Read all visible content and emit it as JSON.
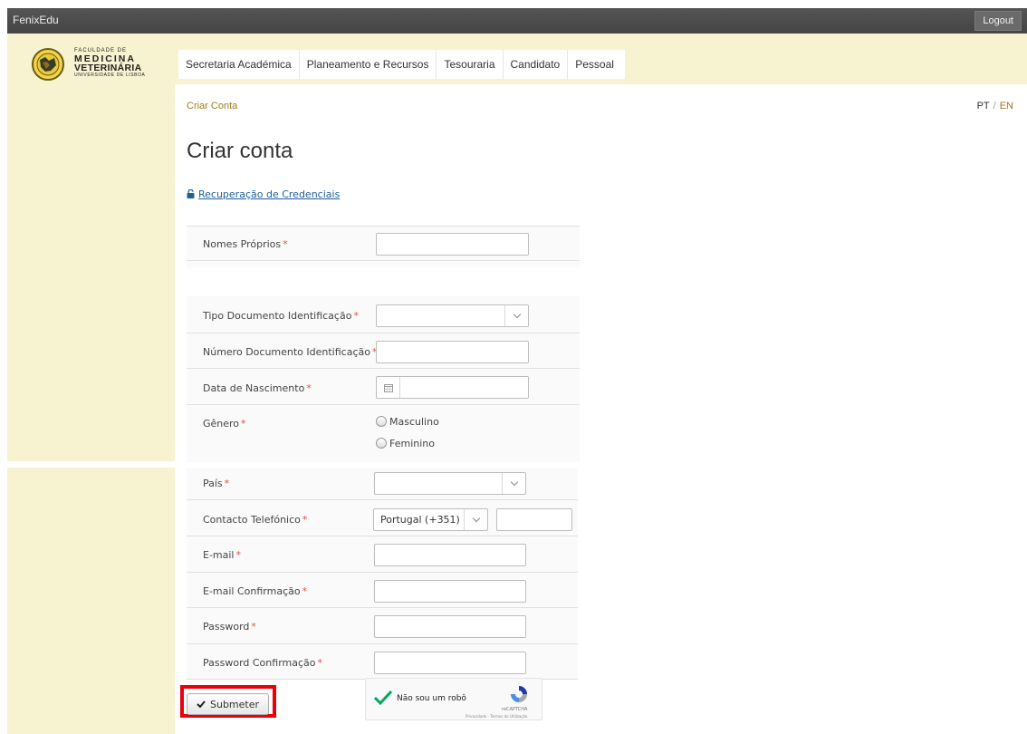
{
  "topbar": {
    "brand": "FenixEdu",
    "logout_label": "Logout"
  },
  "logo": {
    "line1": "FACULDADE DE",
    "line2": "MEDICINA",
    "line3": "VETERINÁRIA",
    "line4": "UNIVERSIDADE DE LISBOA"
  },
  "nav": {
    "items": [
      {
        "label": "Secretaria Académica"
      },
      {
        "label": "Planeamento e Recursos"
      },
      {
        "label": "Tesouraria"
      },
      {
        "label": "Candidato"
      },
      {
        "label": "Pessoal"
      }
    ]
  },
  "breadcrumb": "Criar Conta",
  "lang": {
    "pt": "PT",
    "sep": "/",
    "en": "EN"
  },
  "page_title": "Criar conta",
  "recovery_link": "Recuperação de Credenciais",
  "form": {
    "required_marker": "*",
    "nomes_proprios": {
      "label": "Nomes Próprios",
      "value": ""
    },
    "tipo_documento": {
      "label": "Tipo Documento Identificação",
      "value": ""
    },
    "numero_documento": {
      "label": "Número Documento Identificação",
      "value": ""
    },
    "data_nascimento": {
      "label": "Data de Nascimento",
      "value": ""
    },
    "genero": {
      "label": "Gênero",
      "options": [
        "Masculino",
        "Feminino"
      ]
    },
    "pais": {
      "label": "País",
      "value": ""
    },
    "contacto": {
      "label": "Contacto Telefónico",
      "country": "Portugal (+351)",
      "number": ""
    },
    "email": {
      "label": "E-mail",
      "value": ""
    },
    "email_confirm": {
      "label": "E-mail Confirmação",
      "value": ""
    },
    "password": {
      "label": "Password",
      "value": ""
    },
    "password_confirm": {
      "label": "Password Confirmação",
      "value": ""
    }
  },
  "submit_label": "Submeter",
  "captcha": {
    "label": "Não sou um robô",
    "brand": "reCAPTCHA",
    "links": "Privacidade - Termos de Utilização"
  },
  "colors": {
    "sidebar_bg": "#f7f2d0",
    "topbar_bg": "#4e4e4e",
    "link_gold": "#9b7e1d",
    "required_red": "#d9534f",
    "highlight_red": "#e8000b"
  }
}
